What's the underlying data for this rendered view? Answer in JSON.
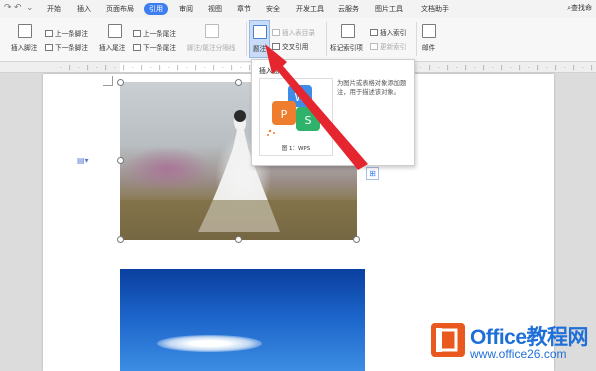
{
  "menubar": {
    "items": [
      "开始",
      "插入",
      "页面布局",
      "引用",
      "审阅",
      "视图",
      "章节",
      "安全",
      "开发工具",
      "云服务",
      "图片工具",
      "文档助手"
    ],
    "active_index": 3,
    "search_label": "查找命"
  },
  "ribbon": {
    "insert_footnote": "插入脚注",
    "prev_footnote": "上一条脚注",
    "next_footnote": "下一条脚注",
    "insert_endnote": "插入尾注",
    "prev_endnote": "上一条尾注",
    "next_endnote": "下一条尾注",
    "separator": "脚注/尾注分隔线",
    "caption": "题注",
    "insert_table_of_figures": "插入表目录",
    "cross_reference": "交叉引用",
    "mark_index": "标记索引项",
    "insert_index": "插入索引",
    "update_index": "更新索引",
    "mail": "邮件"
  },
  "tooltip": {
    "title": "插入题注",
    "caption_sample": "图 1：WPS",
    "description": "为图片或表格对象添加题注，用于描述该对象。"
  },
  "watermark": {
    "title": "Office教程网",
    "url": "www.office26.com"
  },
  "colors": {
    "accent": "#3c7ef0",
    "arrow": "#e5262f",
    "watermark": "#1f6fd8"
  }
}
